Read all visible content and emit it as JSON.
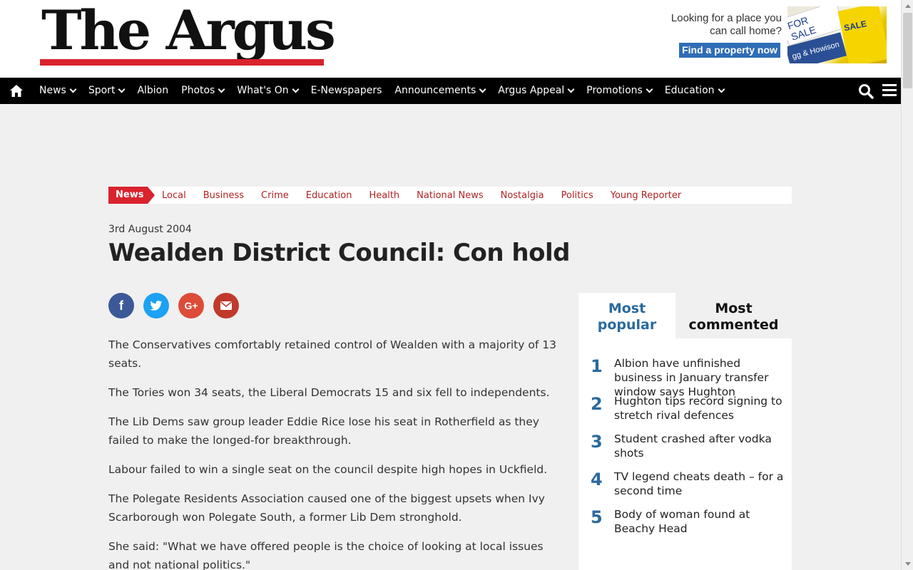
{
  "site": {
    "logo_text": "The Argus"
  },
  "ad": {
    "text": "Looking for a place you can call home?",
    "button": "Find a property now",
    "sign1": "FOR SALE",
    "sign2": "SALE",
    "sign3": "gg & Howison"
  },
  "nav": {
    "items": [
      {
        "label": "News",
        "caret": true
      },
      {
        "label": "Sport",
        "caret": true
      },
      {
        "label": "Albion",
        "caret": false
      },
      {
        "label": "Photos",
        "caret": true
      },
      {
        "label": "What's On",
        "caret": true
      },
      {
        "label": "E-Newspapers",
        "caret": false
      },
      {
        "label": "Announcements",
        "caret": true
      },
      {
        "label": "Argus Appeal",
        "caret": true
      },
      {
        "label": "Promotions",
        "caret": true
      },
      {
        "label": "Education",
        "caret": true
      }
    ]
  },
  "section": {
    "tag": "News",
    "links": [
      "Local",
      "Business",
      "Crime",
      "Education",
      "Health",
      "National News",
      "Nostalgia",
      "Politics",
      "Young Reporter"
    ]
  },
  "article": {
    "date": "3rd August 2004",
    "title": "Wealden District Council: Con hold",
    "paragraphs": [
      "The Conservatives comfortably retained control of Wealden with a majority of 13 seats.",
      "The Tories won 34 seats, the Liberal Democrats 15 and six fell to independents.",
      "The Lib Dems saw group leader Eddie Rice lose his seat in Rotherfield as they failed to make the longed-for breakthrough.",
      "Labour failed to win a single seat on the council despite high hopes in Uckfield.",
      "The Polegate Residents Association caused one of the biggest upsets when Ivy Scarborough won Polegate South, a former Lib Dem stronghold.",
      "She said: \"What we have offered people is the choice of looking at local issues and not national politics.\""
    ]
  },
  "share": {
    "facebook": "f",
    "twitter": "t",
    "google": "G+"
  },
  "sidebar": {
    "tab_popular": "Most popular",
    "tab_commented": "Most commented",
    "items": [
      {
        "num": "1",
        "text": "Albion have unfinished business in January transfer window says Hughton"
      },
      {
        "num": "2",
        "text": "Hughton tips record signing to stretch rival defences"
      },
      {
        "num": "3",
        "text": "Student crashed after vodka shots"
      },
      {
        "num": "4",
        "text": "TV legend cheats death – for a second time"
      },
      {
        "num": "5",
        "text": "Body of woman found at Beachy Head"
      }
    ]
  },
  "colors": {
    "brand_red": "#d9232d",
    "nav_bg": "#000000",
    "accent_blue": "#2a6a9e"
  }
}
